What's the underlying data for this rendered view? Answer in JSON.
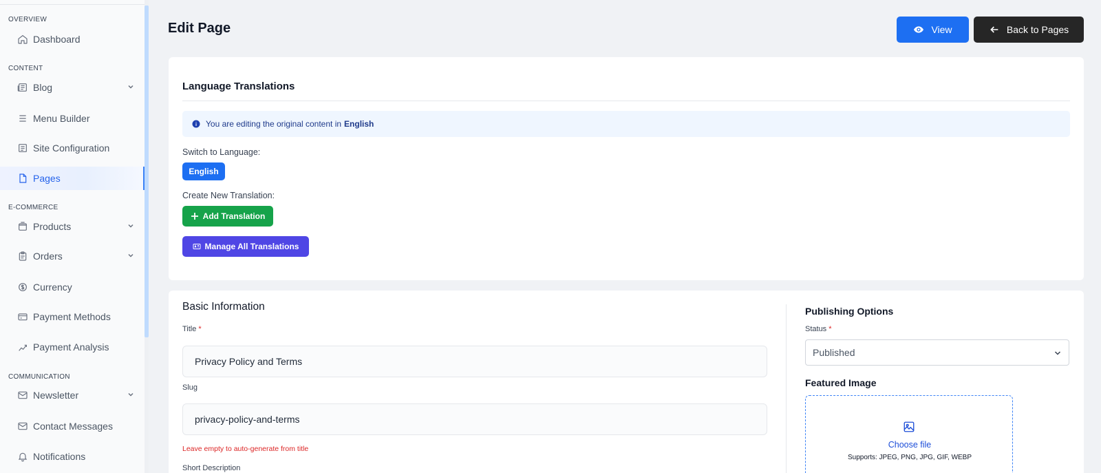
{
  "sidebar": {
    "sections": {
      "overview": "OVERVIEW",
      "content": "CONTENT",
      "ecommerce": "E-COMMERCE",
      "communication": "COMMUNICATION"
    },
    "items": {
      "dashboard": "Dashboard",
      "blog": "Blog",
      "menu_builder": "Menu Builder",
      "site_configuration": "Site Configuration",
      "pages": "Pages",
      "products": "Products",
      "orders": "Orders",
      "currency": "Currency",
      "payment_methods": "Payment Methods",
      "payment_analysis": "Payment Analysis",
      "newsletter": "Newsletter",
      "contact_messages": "Contact Messages",
      "notifications": "Notifications"
    },
    "active_item": "Pages"
  },
  "header": {
    "title": "Edit Page",
    "view_label": "View",
    "back_label": "Back to Pages"
  },
  "translations": {
    "title": "Language Translations",
    "info_prefix": "You are editing the original content in",
    "info_language": "English",
    "switch_label": "Switch to Language:",
    "current_language": "English",
    "create_label": "Create New Translation:",
    "add_label": "Add Translation",
    "manage_label": "Manage All Translations"
  },
  "basic": {
    "title": "Basic Information",
    "title_label": "Title",
    "title_value": "Privacy Policy and Terms",
    "slug_label": "Slug",
    "slug_value": "privacy-policy-and-terms",
    "slug_hint": "Leave empty to auto-generate from title",
    "short_desc_label": "Short Description",
    "required_mark": "*"
  },
  "publishing": {
    "title": "Publishing Options",
    "status_label": "Status",
    "status_value": "Published",
    "featured_label": "Featured Image",
    "choose_file": "Choose file",
    "supports": "Supports: JPEG, PNG, JPG, GIF, WEBP"
  },
  "colors": {
    "primary": "#1d6ff2",
    "dark": "#262626",
    "success": "#16a34a",
    "indigo": "#4f46e5",
    "danger": "#dc2626"
  }
}
